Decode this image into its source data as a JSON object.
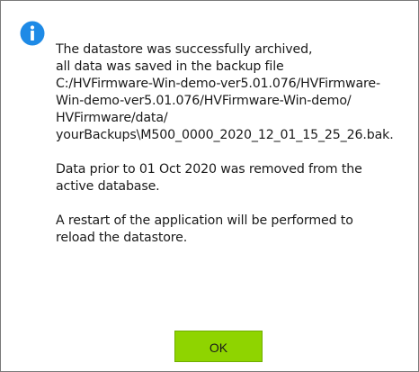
{
  "dialog": {
    "icon": "info-icon",
    "accent_color": "#1e8ae6",
    "message": {
      "paragraph1": [
        "The datastore was successfully archived,",
        "all data was saved in the backup file",
        "C:/HVFirmware-Win-demo-ver5.01.076/HVFirmware-",
        "Win-demo-ver5.01.076/HVFirmware-Win-demo/",
        "HVFirmware/data/",
        "yourBackups\\M500_0000_2020_12_01_15_25_26.bak."
      ],
      "paragraph2": [
        "Data prior to 01 Oct 2020 was removed from the",
        "active database."
      ],
      "paragraph3": [
        "A restart of the application will be performed to",
        "reload the datastore."
      ]
    },
    "ok_label": "OK",
    "ok_color": "#8fd400"
  }
}
